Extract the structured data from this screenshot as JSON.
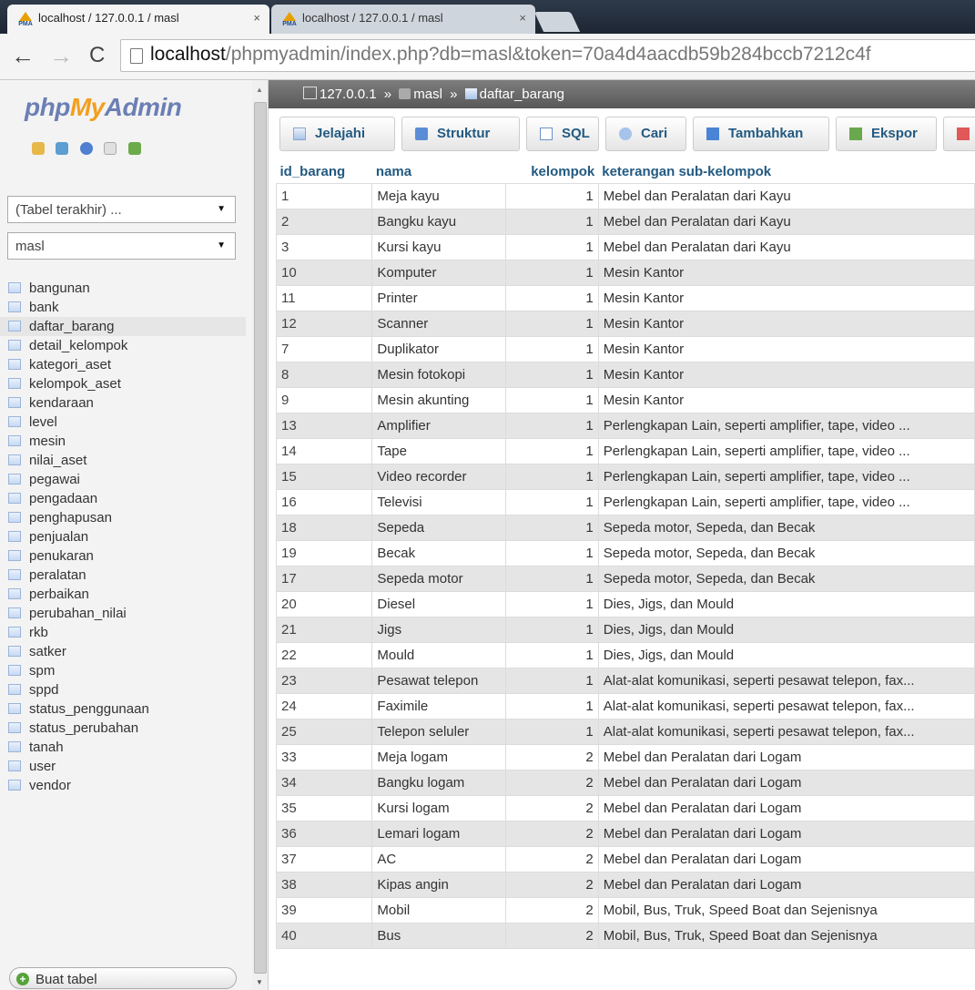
{
  "browser": {
    "tabs": [
      {
        "title": "localhost / 127.0.0.1 / masl",
        "close": "×"
      },
      {
        "title": "localhost / 127.0.0.1 / masl",
        "close": "×"
      }
    ],
    "favicon_text": "PMA",
    "url_host": "localhost",
    "url_rest": "/phpmyadmin/index.php?db=masl&token=70a4d4aacdb59b284bccb7212c4f",
    "back": "←",
    "forward": "→",
    "reload": "C"
  },
  "sidebar": {
    "logo": {
      "php": "php",
      "my": "My",
      "admin": "Admin"
    },
    "recent_tables": "(Tabel terakhir) ...",
    "database": "masl",
    "dropdown_arrow": "▼",
    "tables": [
      "bangunan",
      "bank",
      "daftar_barang",
      "detail_kelompok",
      "kategori_aset",
      "kelompok_aset",
      "kendaraan",
      "level",
      "mesin",
      "nilai_aset",
      "pegawai",
      "pengadaan",
      "penghapusan",
      "penjualan",
      "penukaran",
      "peralatan",
      "perbaikan",
      "perubahan_nilai",
      "rkb",
      "satker",
      "spm",
      "sppd",
      "status_penggunaan",
      "status_perubahan",
      "tanah",
      "user",
      "vendor"
    ],
    "selected_table": "daftar_barang",
    "create_table": "Buat tabel"
  },
  "breadcrumb": {
    "server": "127.0.0.1",
    "database": "masl",
    "table": "daftar_barang",
    "separator": "»"
  },
  "tabs": {
    "browse": "Jelajahi",
    "structure": "Struktur",
    "sql": "SQL",
    "search": "Cari",
    "insert": "Tambahkan",
    "export": "Ekspor"
  },
  "table": {
    "columns": [
      "id_barang",
      "nama",
      "kelompok",
      "keterangan sub-kelompok"
    ],
    "rows": [
      [
        "1",
        "Meja kayu",
        "1",
        "Mebel dan Peralatan dari Kayu"
      ],
      [
        "2",
        "Bangku kayu",
        "1",
        "Mebel dan Peralatan dari Kayu"
      ],
      [
        "3",
        "Kursi kayu",
        "1",
        "Mebel dan Peralatan dari Kayu"
      ],
      [
        "10",
        "Komputer",
        "1",
        "Mesin Kantor"
      ],
      [
        "11",
        "Printer",
        "1",
        "Mesin Kantor"
      ],
      [
        "12",
        "Scanner",
        "1",
        "Mesin Kantor"
      ],
      [
        "7",
        "Duplikator",
        "1",
        "Mesin Kantor"
      ],
      [
        "8",
        "Mesin fotokopi",
        "1",
        "Mesin Kantor"
      ],
      [
        "9",
        "Mesin akunting",
        "1",
        "Mesin Kantor"
      ],
      [
        "13",
        "Amplifier",
        "1",
        "Perlengkapan Lain, seperti amplifier, tape, video ..."
      ],
      [
        "14",
        "Tape",
        "1",
        "Perlengkapan Lain, seperti amplifier, tape, video ..."
      ],
      [
        "15",
        "Video recorder",
        "1",
        "Perlengkapan Lain, seperti amplifier, tape, video ..."
      ],
      [
        "16",
        "Televisi",
        "1",
        "Perlengkapan Lain, seperti amplifier, tape, video ..."
      ],
      [
        "18",
        "Sepeda",
        "1",
        "Sepeda motor, Sepeda, dan Becak"
      ],
      [
        "19",
        "Becak",
        "1",
        "Sepeda motor, Sepeda, dan Becak"
      ],
      [
        "17",
        "Sepeda motor",
        "1",
        "Sepeda motor, Sepeda, dan Becak"
      ],
      [
        "20",
        "Diesel",
        "1",
        "Dies, Jigs, dan Mould"
      ],
      [
        "21",
        "Jigs",
        "1",
        "Dies, Jigs, dan Mould"
      ],
      [
        "22",
        "Mould",
        "1",
        "Dies, Jigs, dan Mould"
      ],
      [
        "23",
        "Pesawat telepon",
        "1",
        "Alat-alat komunikasi, seperti pesawat telepon, fax..."
      ],
      [
        "24",
        "Faximile",
        "1",
        "Alat-alat komunikasi, seperti pesawat telepon, fax..."
      ],
      [
        "25",
        "Telepon seluler",
        "1",
        "Alat-alat komunikasi, seperti pesawat telepon, fax..."
      ],
      [
        "33",
        "Meja logam",
        "2",
        "Mebel dan Peralatan dari Logam"
      ],
      [
        "34",
        "Bangku logam",
        "2",
        "Mebel dan Peralatan dari Logam"
      ],
      [
        "35",
        "Kursi logam",
        "2",
        "Mebel dan Peralatan dari Logam"
      ],
      [
        "36",
        "Lemari logam",
        "2",
        "Mebel dan Peralatan dari Logam"
      ],
      [
        "37",
        "AC",
        "2",
        "Mebel dan Peralatan dari Logam"
      ],
      [
        "38",
        "Kipas angin",
        "2",
        "Mebel dan Peralatan dari Logam"
      ],
      [
        "39",
        "Mobil",
        "2",
        "Mobil, Bus, Truk, Speed Boat dan Sejenisnya"
      ],
      [
        "40",
        "Bus",
        "2",
        "Mobil, Bus, Truk, Speed Boat dan Sejenisnya"
      ]
    ]
  },
  "colors": {
    "link": "#235a81",
    "breadcrumb_bg": "#666666",
    "row_alt": "#e5e5e5",
    "logo_orange": "#f29f1f",
    "logo_blue": "#6b7fb4"
  }
}
